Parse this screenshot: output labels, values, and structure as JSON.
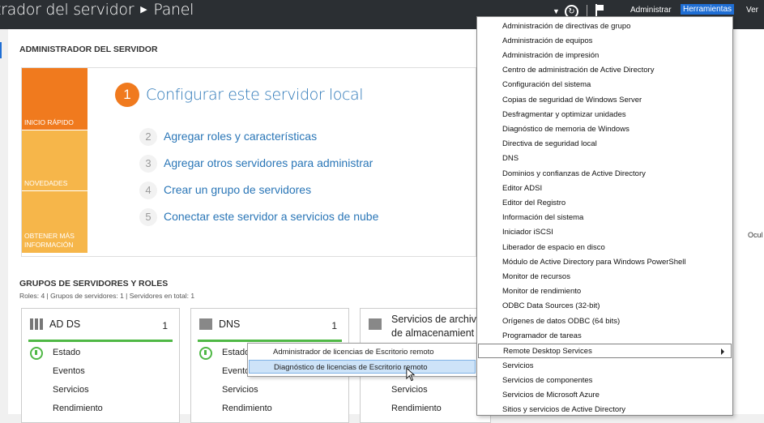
{
  "titlebar": {
    "title_part1": "trador del servidor",
    "title_part2": "Panel",
    "menu_admin": "Administrar",
    "menu_tools": "Herramientas",
    "menu_view": "Ver"
  },
  "main": {
    "heading": "ADMINISTRADOR DEL SERVIDOR",
    "tiles": [
      "INICIO RÁPIDO",
      "NOVEDADES",
      "OBTENER MÁS INFORMACIÓN"
    ],
    "step1": {
      "num": "1",
      "label": "Configurar este servidor local"
    },
    "steps": [
      {
        "num": "2",
        "label": "Agregar roles y características"
      },
      {
        "num": "3",
        "label": "Agregar otros servidores para administrar"
      },
      {
        "num": "4",
        "label": "Crear un grupo de servidores"
      },
      {
        "num": "5",
        "label": "Conectar este servidor a servicios de nube"
      }
    ],
    "side_label": "Ocul",
    "groups_title": "GRUPOS DE SERVIDORES Y ROLES",
    "groups_sub": "Roles: 4   |   Grupos de servidores: 1   |   Servidores en total: 1",
    "cards": [
      {
        "title": "AD DS",
        "count": "1",
        "rows": [
          "Estado",
          "Eventos",
          "Servicios",
          "Rendimiento"
        ]
      },
      {
        "title": "DNS",
        "count": "1",
        "rows": [
          "Estado",
          "Eventos",
          "Servicios",
          "Rendimiento"
        ]
      },
      {
        "title_line1": "Servicios de archiv",
        "title_line2": "de almacenamient",
        "rows": [
          "Servicios",
          "Rendimiento"
        ]
      }
    ]
  },
  "tools_menu": [
    "Administración de directivas de grupo",
    "Administración de equipos",
    "Administración de impresión",
    "Centro de administración de Active Directory",
    "Configuración del sistema",
    "Copias de seguridad de Windows Server",
    "Desfragmentar y optimizar unidades",
    "Diagnóstico de memoria de Windows",
    "Directiva de seguridad local",
    "DNS",
    "Dominios y confianzas de Active Directory",
    "Editor ADSI",
    "Editor del Registro",
    "Información del sistema",
    "Iniciador iSCSI",
    "Liberador de espacio en disco",
    "Módulo de Active Directory para Windows PowerShell",
    "Monitor de recursos",
    "Monitor de rendimiento",
    "ODBC Data Sources (32-bit)",
    "Orígenes de datos ODBC (64 bits)",
    "Programador de tareas",
    "Remote Desktop Services",
    "Servicios",
    "Servicios de componentes",
    "Servicios de Microsoft Azure",
    "Sitios y servicios de Active Directory"
  ],
  "submenu": [
    "Administrador de licencias de Escritorio remoto",
    "Diagnóstico de licencias de Escritorio remoto"
  ]
}
